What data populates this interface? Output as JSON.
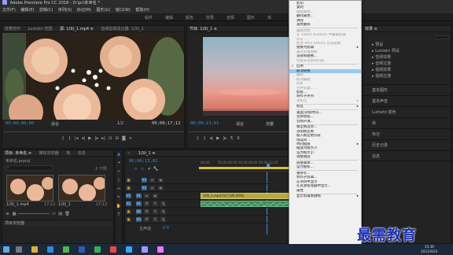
{
  "window": {
    "title": "Adobe Premiere Pro CC 2018 - D:\\pr\\未命名 *"
  },
  "menubar": [
    "文件(F)",
    "编辑(E)",
    "剪辑(C)",
    "序列(S)",
    "标记(M)",
    "图形(G)",
    "窗口(W)",
    "帮助(H)"
  ],
  "workspaces": [
    "组件",
    "编辑",
    "颜色",
    "效果",
    "音频",
    "图形",
    "库"
  ],
  "source_panel": {
    "tabs": [
      "效果控件",
      "Lumetri 范围",
      "源: 1(9)_1.mp4 ≡",
      "音频剪辑混合器: 1(9)_1"
    ],
    "timecode_left": "00;00;00;00",
    "fit": "适合",
    "ratio": "1/2",
    "timecode_right": "00;00;17;12"
  },
  "program_panel": {
    "tabs": [
      "节目: 1(9)_1 ≡"
    ],
    "timecode_left": "00;00;13;01",
    "fit": "适合",
    "ratio": "完整"
  },
  "project_panel": {
    "tabs": [
      "项目: 未命名 ≡",
      "媒体浏览器",
      "库",
      "信息"
    ],
    "file": "未命名.prproj",
    "count": "2 个项",
    "clips": [
      {
        "name": "1(9)_1.mp4",
        "duration": "17;12"
      },
      {
        "name": "1(9)_1",
        "duration": "17;12"
      }
    ]
  },
  "history_tab": "项目浏览器",
  "timeline": {
    "tab": "1(9)_1 ≡",
    "timecode": "00;00;13;01",
    "ruler": [
      "00;00",
      "00;00;04;00",
      "00;00;08;00",
      "00;00;12;00",
      "00;00;16;00"
    ],
    "video_tracks": [
      "V3",
      "V2",
      "V1"
    ],
    "audio_tracks": [
      "A1",
      "A2",
      "A3"
    ],
    "master": "主声道",
    "master_value": "0.0",
    "video_clip": "1(9)_1.mp4 [V] [100.00%]"
  },
  "right_panel": {
    "tabs": [
      "效果 ≡",
      "基本图形",
      "基本声音",
      "Lumetri 颜色",
      "库",
      "标记",
      "历史记录",
      "信息"
    ],
    "effects_items": [
      "预设",
      "Lumetri 预设",
      "音频效果",
      "音频过渡",
      "视频效果",
      "视频过渡"
    ],
    "section_items": [
      "基本图形",
      "基本声音",
      "Lumetri 颜色",
      "库",
      "标记",
      "历史记录",
      "信息"
    ]
  },
  "context_menu": {
    "items": [
      {
        "label": "剪切",
        "state": "normal"
      },
      {
        "label": "复制",
        "state": "normal"
      },
      {
        "label": "粘贴属性...",
        "state": "disabled"
      },
      {
        "label": "删除属性...",
        "state": "normal"
      },
      {
        "label": "清除",
        "state": "normal"
      },
      {
        "label": "波纹删除",
        "state": "normal"
      },
      {
        "label": "",
        "state": "sep"
      },
      {
        "label": "编辑原始",
        "state": "disabled"
      },
      {
        "label": "在 Adobe Audition 中编辑剪辑",
        "state": "disabled"
      },
      {
        "label": "许可...",
        "state": "disabled"
      },
      {
        "label": "使用 After Effects 合成替换",
        "state": "disabled"
      },
      {
        "label": "替换为剪辑",
        "state": "normal",
        "submenu": true
      },
      {
        "label": "通过剪辑替换",
        "state": "disabled"
      },
      {
        "label": "渲染和替换...",
        "state": "normal"
      },
      {
        "label": "恢复未渲染的内容",
        "state": "disabled"
      },
      {
        "label": "",
        "state": "sep"
      },
      {
        "label": "启用",
        "state": "checked"
      },
      {
        "label": "取消链接",
        "state": "highlight"
      },
      {
        "label": "编组",
        "state": "disabled"
      },
      {
        "label": "取消编组",
        "state": "disabled"
      },
      {
        "label": "同步",
        "state": "disabled"
      },
      {
        "label": "合并剪辑...",
        "state": "disabled"
      },
      {
        "label": "嵌套...",
        "state": "normal"
      },
      {
        "label": "制作子序列",
        "state": "normal"
      },
      {
        "label": "多机位",
        "state": "disabled",
        "submenu": true
      },
      {
        "label": "",
        "state": "sep"
      },
      {
        "label": "标签",
        "state": "normal",
        "submenu": true
      },
      {
        "label": "",
        "state": "sep"
      },
      {
        "label": "速度/持续时间...",
        "state": "normal"
      },
      {
        "label": "音频增益...",
        "state": "normal"
      },
      {
        "label": "音频声道...",
        "state": "normal"
      },
      {
        "label": "",
        "state": "sep"
      },
      {
        "label": "帧定格选项...",
        "state": "normal"
      },
      {
        "label": "添加帧定格",
        "state": "normal"
      },
      {
        "label": "插入帧定格分段",
        "state": "normal"
      },
      {
        "label": "场选项...",
        "state": "normal"
      },
      {
        "label": "时间插值",
        "state": "normal",
        "submenu": true
      },
      {
        "label": "缩放为帧大小",
        "state": "normal"
      },
      {
        "label": "设为帧大小",
        "state": "normal"
      },
      {
        "label": "调整图层",
        "state": "normal"
      },
      {
        "label": "",
        "state": "sep"
      },
      {
        "label": "链接媒体...",
        "state": "normal"
      },
      {
        "label": "设为脱机...",
        "state": "normal"
      },
      {
        "label": "",
        "state": "sep"
      },
      {
        "label": "重命名...",
        "state": "normal"
      },
      {
        "label": "制作子剪辑...",
        "state": "normal"
      },
      {
        "label": "在项目中显示",
        "state": "normal"
      },
      {
        "label": "在资源管理器中显示...",
        "state": "normal"
      },
      {
        "label": "属性",
        "state": "normal"
      },
      {
        "label": "",
        "state": "sep"
      },
      {
        "label": "显示剪辑关键帧",
        "state": "normal",
        "submenu": true
      }
    ]
  },
  "watermark": "最需教育",
  "taskbar": {
    "time": "15:39",
    "date": "2021/9/23"
  },
  "colors": {
    "accent": "#3b8cd6",
    "highlight": "#99c9ef",
    "video_clip": "#b7a93a",
    "audio_clip": "#3c8a58"
  }
}
